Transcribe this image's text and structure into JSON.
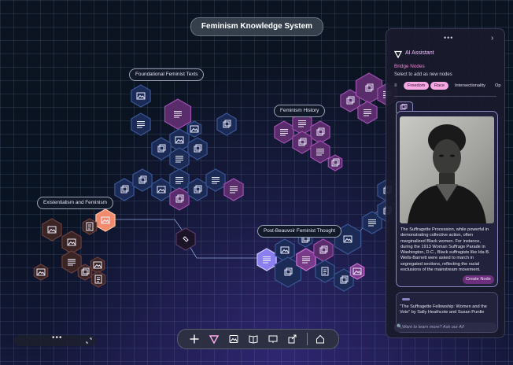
{
  "app": {
    "title": "Feminism Knowledge System"
  },
  "canvas": {
    "labels": {
      "foundational": "Foundational Feminist Texts",
      "history": "Feminism History",
      "existentialism": "Existentialism and Feminism",
      "postbeauvoir": "Post-Beauvoir Feminist Thought"
    }
  },
  "panel": {
    "more": "•••",
    "collapse": "›",
    "title": "AI Assistant",
    "bridge_title": "Bridge Nodes",
    "bridge_sub": "Select to add as new nodes",
    "tag_icon": "≡",
    "tags": [
      "Freedom",
      "Race",
      "Intersectionality",
      "Op"
    ],
    "card": {
      "text": "The Suffragette Procession, while powerful in demonstrating collective action, often marginalized Black women. For instance, during the 1913 Woman Suffrage Parade in Washington, D.C., Black suffragists like Ida B. Wells-Barnett were asked to march in segregated sections, reflecting the racial exclusions of the mainstream movement.",
      "button": "Create Node"
    },
    "card2": {
      "text": "\"The Suffragette Fellowship: Women and the Vote\" by Sally Heathcote and Susan Purdie"
    },
    "ask": {
      "icon": "🔍",
      "placeholder": "Want to learn more? Ask our AI!"
    }
  },
  "toolbar": {
    "items": [
      "add",
      "ai-assistant",
      "image",
      "book",
      "slides",
      "share",
      "home"
    ]
  },
  "minimap": {
    "dots": "•••"
  },
  "colors": {
    "accent": "#f6a8e3",
    "node_navy": "#1b2b55",
    "node_purple": "#5b2c6b",
    "node_orange": "#f08c6d",
    "node_violet": "#8a7ef0"
  }
}
